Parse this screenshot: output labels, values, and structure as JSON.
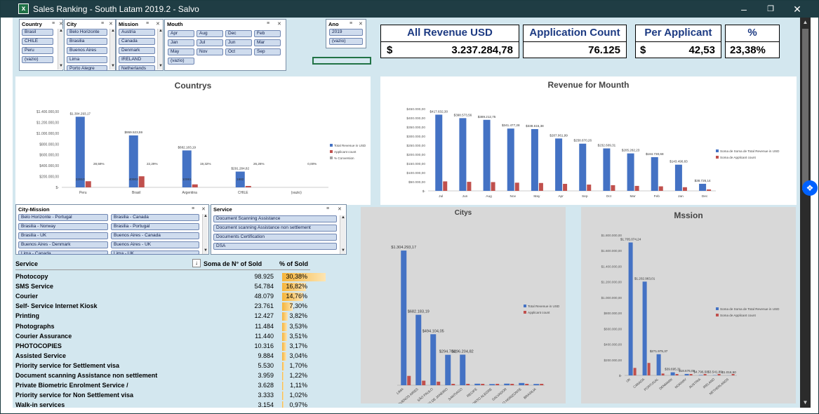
{
  "window": {
    "title": "Sales Ranking - South Latam 2019.2 - Salvo",
    "app_icon": "excel-icon"
  },
  "slicers": {
    "country": {
      "header": "Country",
      "items": [
        "Brasil",
        "CHILE",
        "Peru",
        "(vazio)"
      ]
    },
    "city": {
      "header": "City",
      "items": [
        "Belo Horizonte",
        "Brasilia",
        "Buenos Aires",
        "Lima",
        "Porto Alegre"
      ]
    },
    "mission": {
      "header": "Mission",
      "items": [
        "Austria",
        "Canada",
        "Denmark",
        "IRELAND",
        "Netherlands"
      ]
    },
    "mouth": {
      "header": "Mouth",
      "items": [
        "Apr",
        "Aug",
        "Dec",
        "Feb",
        "Jan",
        "Jul",
        "Jun",
        "Mar",
        "May",
        "Nov",
        "Oct",
        "Sep",
        "(vazio)"
      ]
    },
    "ano": {
      "header": "Ano",
      "items": [
        "2019",
        "(vazio)"
      ]
    },
    "city_mission": {
      "header": "City-Mission",
      "items": [
        "Belo Horizonte - Portugal",
        "Brasilia - Canada",
        "Brasilia - Norway",
        "Brasilia - Portugal",
        "Brasilia - UK",
        "Buenos Aires - Canada",
        "Buenos Aires - Denmark",
        "Buenos Aires - UK",
        "Lima - Canada",
        "Lima - UK"
      ]
    },
    "service": {
      "header": "Service",
      "items": [
        "Document Scanning Assistance",
        "Document scanning Assistance non settlement",
        "Documents Certification",
        "DSA"
      ]
    }
  },
  "kpis": [
    {
      "label": "All Revenue USD",
      "currency": "$",
      "value": "3.237.284,78"
    },
    {
      "label": "Application Count",
      "currency": "",
      "value": "76.125"
    },
    {
      "label": "Per Applicant",
      "currency": "$",
      "value": "42,53"
    },
    {
      "label": "%",
      "currency": "",
      "value": "23,38%"
    }
  ],
  "table": {
    "headers": {
      "service": "Service",
      "sold": "Soma de N° of Sold",
      "pct": "% of Sold"
    },
    "rows": [
      {
        "name": "Photocopy",
        "sold": "98.925",
        "pct": "30,38%",
        "frac": 0.3038
      },
      {
        "name": "SMS Service",
        "sold": "54.784",
        "pct": "16,82%",
        "frac": 0.1682
      },
      {
        "name": "Courier",
        "sold": "48.079",
        "pct": "14,76%",
        "frac": 0.1476
      },
      {
        "name": "Self- Service Internet Kiosk",
        "sold": "23.761",
        "pct": "7,30%",
        "frac": 0.073
      },
      {
        "name": "Printing",
        "sold": "12.427",
        "pct": "3,82%",
        "frac": 0.0382
      },
      {
        "name": "Photographs",
        "sold": "11.484",
        "pct": "3,53%",
        "frac": 0.0353
      },
      {
        "name": "Courier Assurance",
        "sold": "11.440",
        "pct": "3,51%",
        "frac": 0.0351
      },
      {
        "name": "PHOTOCOPIES",
        "sold": "10.316",
        "pct": "3,17%",
        "frac": 0.0317
      },
      {
        "name": "Assisted Service",
        "sold": "9.884",
        "pct": "3,04%",
        "frac": 0.0304
      },
      {
        "name": "Priority service for Settlement visa",
        "sold": "5.530",
        "pct": "1,70%",
        "frac": 0.017
      },
      {
        "name": "Document scanning Assistance non settlement",
        "sold": "3.959",
        "pct": "1,22%",
        "frac": 0.0122
      },
      {
        "name": "Private Biometric Enrolment Service /",
        "sold": "3.628",
        "pct": "1,11%",
        "frac": 0.0111
      },
      {
        "name": "Priority service for Non Settlement visa",
        "sold": "3.333",
        "pct": "1,02%",
        "frac": 0.0102
      },
      {
        "name": "Walk-in services",
        "sold": "3.154",
        "pct": "0,97%",
        "frac": 0.0097
      }
    ]
  },
  "colors": {
    "revenue": "#4472c4",
    "applicant": "#c0504d",
    "conversion": "#a5a5a5"
  },
  "chart_data": [
    {
      "id": "countrys",
      "type": "bar",
      "title": "Countrys",
      "categories": [
        "Peru",
        "Brasil",
        "Argentina",
        "CHILE",
        "(vazio)"
      ],
      "series": [
        {
          "name": "Total Revenue in USD",
          "values": [
            1304293.17,
            959523.59,
            682183.19,
            291284.82,
            0
          ],
          "labels": [
            "$1.304.293,17",
            "$959.523,59",
            "$682.183,19",
            "$291.284,82",
            ""
          ]
        },
        {
          "name": "Applicant count",
          "values": [
            22610,
            40903,
            10991,
            1682,
            0
          ],
          "labels": [
            "22610",
            "40903",
            "10991",
            "1682",
            ""
          ]
        },
        {
          "name": "% Conversion",
          "values": [
            28.59,
            22.29,
            19.32,
            26.26,
            0
          ],
          "labels": [
            "28,59%",
            "22,29%",
            "19,32%",
            "26,26%",
            "0,00%"
          ]
        }
      ],
      "yticks": [
        "$1.400.000,00",
        "$1.200.000,00",
        "$1.000.000,00",
        "$800.000,00",
        "$600.000,00",
        "$400.000,00",
        "$200.000,00",
        "$-"
      ],
      "ylim": [
        0,
        1400000
      ],
      "legend": "right"
    },
    {
      "id": "revmonth",
      "type": "bar",
      "title": "Revenue for Mounth",
      "categories": [
        "Jul",
        "Jun",
        "Aug",
        "Nov",
        "May",
        "Apr",
        "Sep",
        "Oct",
        "Mar",
        "Feb",
        "Jan",
        "Dec"
      ],
      "series": [
        {
          "name": "Soma de Soma de Total Revenue in USD",
          "values": [
            417632,
            398573.56,
            389212.75,
            341477.28,
            338615.38,
            287061.99,
            258670.26,
            232609.31,
            205282.23,
            184730.68,
            143490.83,
            38726.14
          ],
          "labels": [
            "$417.632,30",
            "$398.573,56",
            "$389.212,75",
            "$341.477,28",
            "$338.615,38",
            "$287.061,99",
            "$258.670,26",
            "$232.609,31",
            "$205.282,23",
            "$184.730,68",
            "$143.490,83",
            "$38.726,14"
          ]
        },
        {
          "name": "Soma de Applicant count",
          "values": [
            6500,
            6200,
            6000,
            5600,
            5400,
            4800,
            4300,
            3900,
            3400,
            3100,
            2500,
            700
          ]
        }
      ],
      "yticks": [
        "$450.000,00",
        "$400.000,00",
        "$350.000,00",
        "$300.000,00",
        "$250.000,00",
        "$200.000,00",
        "$150.000,00",
        "$100.000,00",
        "$50.000,00",
        "$-"
      ],
      "ylim": [
        0,
        450000
      ],
      "legend": "right"
    },
    {
      "id": "citys",
      "type": "bar",
      "title": "Citys",
      "categories": [
        "LIMA",
        "BUENOS AIRES",
        "SÃO PAULO",
        "RIO DE JANEIRO",
        "SANTIAGO",
        "RECIFE",
        "PORTO ALEGRE",
        "SALVADOR",
        "BELO HORIZONTE",
        "BRASILIA"
      ],
      "series": [
        {
          "name": "Total Revenue in USD",
          "values": [
            1304293.17,
            682183.19,
            494104.05,
            294784.0,
            296204.82,
            14800,
            11300,
            15400,
            21700,
            12100
          ],
          "labels": [
            "$1.304.293,17",
            "$682.183,19",
            "$494.104,05",
            "$294.784,",
            "$296.204,82",
            "",
            "",
            "",
            "",
            ""
          ]
        },
        {
          "name": "Applicant count",
          "values": [
            22610,
            10991,
            8651,
            2216,
            1682,
            600,
            500,
            500,
            700,
            400
          ]
        }
      ],
      "ylim": [
        0,
        1400000
      ],
      "legend": "right"
    },
    {
      "id": "mission",
      "type": "bar",
      "title": "Mssion",
      "categories": [
        "UK",
        "CANADA",
        "PORTUGAL",
        "DENMARK",
        "NORWAY",
        "AUSTRIA",
        "IRELAND",
        "NETHERLANDS"
      ],
      "series": [
        {
          "name": "Soma de Soma de Total Revenue in USD",
          "values": [
            1705074.24,
            1202963.01,
            271975.37,
            39695.31,
            18676.06,
            4796.5,
            3541.89,
            1016.5
          ],
          "labels": [
            "$1.705.074,24",
            "$1.202.963,01",
            "$271.975,37",
            "$39.695,31",
            "$18.676,06",
            "$4.796,50",
            "$3.541,89",
            "$1.016,50"
          ]
        },
        {
          "name": "Soma de Applicant count",
          "values": [
            24000,
            40000,
            6000,
            1000,
            500,
            200,
            150,
            80
          ]
        }
      ],
      "yticks": [
        "$1.800.000,00",
        "$1.600.000,00",
        "$1.400.000,00",
        "$1.200.000,00",
        "$1.000.000,00",
        "$800.000,00",
        "$600.000,00",
        "$400.000,00",
        "$200.000,00",
        "$-"
      ],
      "ylim": [
        0,
        1800000
      ],
      "legend": "right"
    }
  ]
}
